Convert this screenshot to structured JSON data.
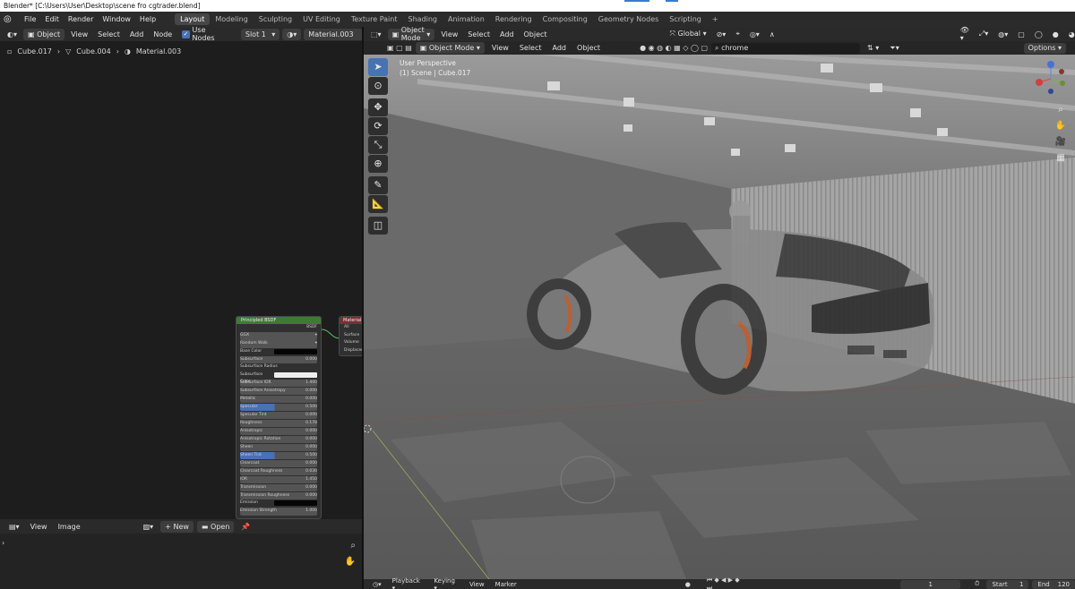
{
  "window": {
    "title": "Blender* [C:\\Users\\User\\Desktop\\scene fro cgtrader.blend]"
  },
  "menu": [
    "File",
    "Edit",
    "Render",
    "Window",
    "Help"
  ],
  "workspaces": [
    "Layout",
    "Modeling",
    "Sculpting",
    "UV Editing",
    "Texture Paint",
    "Shading",
    "Animation",
    "Rendering",
    "Compositing",
    "Geometry Nodes",
    "Scripting"
  ],
  "add_workspace": "+",
  "node_editor": {
    "object_dropdown": "Object",
    "menus": [
      "View",
      "Select",
      "Add",
      "Node"
    ],
    "use_nodes_label": "Use Nodes",
    "slot": "Slot 1",
    "material": "Material.003",
    "breadcrumb": [
      "Cube.017",
      "Cube.004",
      "Material.003"
    ],
    "principled_node": {
      "title": "Principled BSDF",
      "output": "BSDF",
      "distribution": "GGX",
      "subsurface_method": "Random Walk",
      "rows": [
        {
          "label": "Base Color",
          "value": ""
        },
        {
          "label": "Subsurface",
          "value": "0.000"
        },
        {
          "label": "Subsurface Radius",
          "value": ""
        },
        {
          "label": "Subsurface Color",
          "value": ""
        },
        {
          "label": "Subsurface IOR",
          "value": "1.400"
        },
        {
          "label": "Subsurface Anisotropy",
          "value": "0.000"
        },
        {
          "label": "Metallic",
          "value": "0.000"
        },
        {
          "label": "Specular",
          "value": "0.500"
        },
        {
          "label": "Specular Tint",
          "value": "0.000"
        },
        {
          "label": "Roughness",
          "value": "0.178"
        },
        {
          "label": "Anisotropic",
          "value": "0.000"
        },
        {
          "label": "Anisotropic Rotation",
          "value": "0.000"
        },
        {
          "label": "Sheen",
          "value": "0.000"
        },
        {
          "label": "Sheen Tint",
          "value": "0.500"
        },
        {
          "label": "Clearcoat",
          "value": "0.000"
        },
        {
          "label": "Clearcoat Roughness",
          "value": "0.030"
        },
        {
          "label": "IOR",
          "value": "1.450"
        },
        {
          "label": "Transmission",
          "value": "0.000"
        },
        {
          "label": "Transmission Roughness",
          "value": "0.000"
        },
        {
          "label": "Emission",
          "value": ""
        },
        {
          "label": "Emission Strength",
          "value": "1.000"
        }
      ]
    },
    "output_node": {
      "title": "Material",
      "rows": [
        "All",
        "Surface",
        "Volume",
        "Displacement"
      ]
    }
  },
  "image_editor": {
    "menus": [
      "View",
      "Image"
    ],
    "new_label": "New",
    "open_label": "Open"
  },
  "viewport": {
    "mode": "Object Mode",
    "menus": [
      "View",
      "Select",
      "Add",
      "Object"
    ],
    "orientation": "Global",
    "search_value": "chrome",
    "options_label": "Options",
    "perspective_label": "User Perspective",
    "scene_label": "(1) Scene | Cube.017",
    "footer": {
      "menus": [
        "Playback",
        "Keying",
        "View",
        "Marker"
      ],
      "current_frame": "1",
      "start_label": "Start",
      "start_value": "1",
      "end_label": "End",
      "end_value": "120"
    }
  },
  "colors": {
    "accent": "#4772b3",
    "node_green": "#3f7a33",
    "node_red": "#7a2f35"
  }
}
